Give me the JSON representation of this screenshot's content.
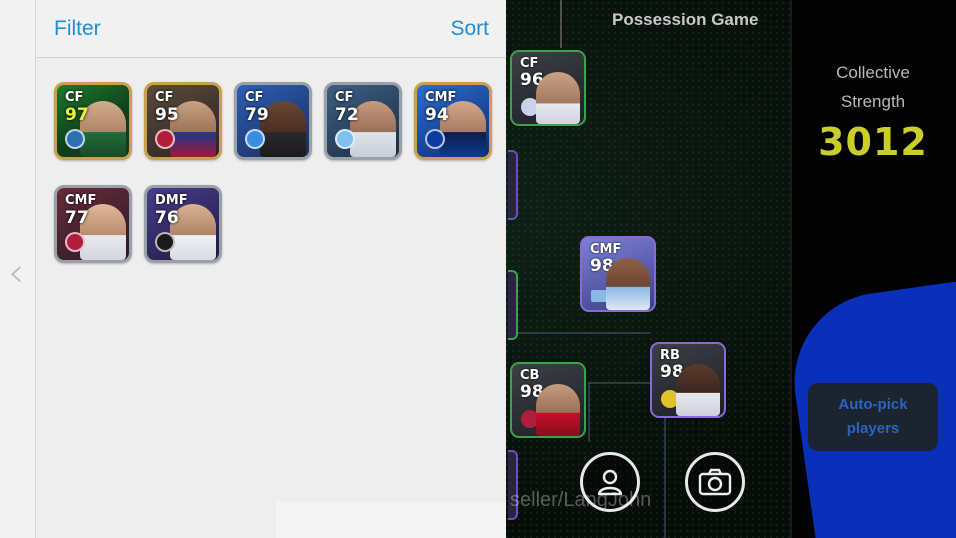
{
  "drawer": {
    "filter_label": "Filter",
    "sort_label": "Sort",
    "cards": [
      {
        "pos": "CF",
        "ovr": "97",
        "ovr_color": "#e8f23a",
        "bg": "linear-gradient(150deg,#1e7a2e,#0f3d1a 60%,#163a26)",
        "face": "linear-gradient(180deg,#d3ad8c 0%,#b08468 55%,#1f6d3a 56%,#1a4a2a 100%)",
        "badge": "#2f6fb0"
      },
      {
        "pos": "CF",
        "ovr": "95",
        "ovr_color": "#ffffff",
        "bg": "linear-gradient(150deg,#5b4b3c,#2a2320)",
        "face": "linear-gradient(180deg,#c9a184 0%,#9d7459 55%,#1b3a8a 56%,#a5163a 100%)",
        "badge": "#b01e3c"
      },
      {
        "pos": "CF",
        "ovr": "79",
        "ovr_color": "#ffffff",
        "bg": "linear-gradient(150deg,#2b5fb8,#1c2c55)",
        "face": "linear-gradient(180deg,#6b4634 0%,#4b2f22 55%,#2a2a2e 56%,#1a1a1d 100%)",
        "badge": "#3a8de0"
      },
      {
        "pos": "CF",
        "ovr": "72",
        "ovr_color": "#ffffff",
        "bg": "linear-gradient(150deg,#3d5f85,#1d2c40)",
        "face": "linear-gradient(180deg,#c69b7e 0%,#9a7158 55%,#dfe3ea 56%,#c9ced8 100%)",
        "badge": "#7fc1ee"
      },
      {
        "pos": "CMF",
        "ovr": "94",
        "ovr_color": "#ffffff",
        "bg": "linear-gradient(150deg,#2d6fd0,#0d2a6e)",
        "face": "linear-gradient(180deg,#d2a88b 0%,#a87c62 55%,#0b1d4d 56%,#123a8c 100%)",
        "badge": "#0d3b9e"
      },
      {
        "pos": "CMF",
        "ovr": "77",
        "ovr_color": "#ffffff",
        "bg": "linear-gradient(150deg,#6a2b3b,#2a1a24)",
        "face": "linear-gradient(180deg,#e0b89a 0%,#b98c6f 55%,#e9e9ee 56%,#d4d6de 100%)",
        "badge": "#b01e3c"
      },
      {
        "pos": "DMF",
        "ovr": "76",
        "ovr_color": "#ffffff",
        "bg": "linear-gradient(150deg,#4a3d8f,#1f1a3c)",
        "face": "linear-gradient(180deg,#d9b292 0%,#ad8468 55%,#f0f0f3 56%,#d9dbe2 100%)",
        "badge": "#1a1a1a"
      }
    ]
  },
  "game": {
    "title": "Possession Game",
    "strength_label_line1": "Collective",
    "strength_label_line2": "Strength",
    "strength_value": "3012",
    "autopick_line1": "Auto-pick",
    "autopick_line2": "players",
    "watermark": "seller/LangJohn",
    "pitch_cards": [
      {
        "pos": "CF",
        "ovr": "96",
        "border": "#3aa34a"
      },
      {
        "pos": "CMF",
        "ovr": "98",
        "border": "#8a6ad8"
      },
      {
        "pos": "CB",
        "ovr": "98",
        "border": "#3aa34a"
      },
      {
        "pos": "RB",
        "ovr": "98",
        "border": "#8a6ad8"
      }
    ]
  },
  "icons": {
    "back": "chevron-left-icon",
    "player": "user-icon",
    "camera": "camera-icon"
  }
}
